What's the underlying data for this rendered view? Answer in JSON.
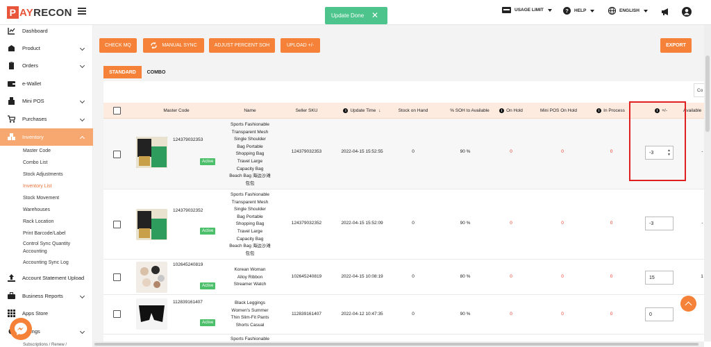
{
  "logo": {
    "boxed_letter": "P",
    "rest_a": "AY",
    "rest_b": "RECON"
  },
  "toast": {
    "message": "Update Done",
    "close": "✕"
  },
  "topbar": {
    "usage": "USAGE LIMIT",
    "help": "HELP",
    "language": "ENGLISH"
  },
  "sidebar": {
    "items": [
      {
        "label": "Dashboard",
        "icon": "chart-icon"
      },
      {
        "label": "Product",
        "icon": "box-icon"
      },
      {
        "label": "Orders",
        "icon": "clipboard-icon"
      },
      {
        "label": "e-Wallet",
        "icon": "wallet-icon"
      },
      {
        "label": "Mini POS",
        "icon": "pos-icon"
      },
      {
        "label": "Purchases",
        "icon": "cart-icon"
      },
      {
        "label": "Inventory",
        "icon": "inventory-icon"
      },
      {
        "label": "Account Statement Upload",
        "icon": "upload-icon"
      },
      {
        "label": "Business Reports",
        "icon": "briefcase-icon"
      },
      {
        "label": "Apps Store",
        "icon": "apps-icon"
      },
      {
        "label": "ings",
        "icon": "settings-icon"
      }
    ],
    "inventory_sub": [
      "Master Code",
      "Combo List",
      "Stock Adjustments",
      "Inventory List",
      "Stock Movement",
      "Warehouses",
      "Rack Location",
      "Print Barcode/Label",
      "Control Sync Quantity",
      "Accounting",
      "Accounting Sync Log"
    ],
    "footer_cut": "Subscriptions / Renew /"
  },
  "toolbar": {
    "check_mq": "CHECK MQ",
    "manual_sync": "MANUAL SYNC",
    "adjust": "ADJUST PERCENT SOH",
    "upload": "UPLOAD +/-",
    "export": "EXPORT"
  },
  "tabs": {
    "standard": "STANDARD",
    "combo": "COMBO"
  },
  "columns_button": "Co",
  "table": {
    "headers": [
      "Master Code",
      "Name",
      "Seller SKU",
      "Update Time",
      "Stock on Hand",
      "% SOH to Available",
      "On Hold",
      "Mini POS On Hold",
      "In Process",
      "+/-",
      "Available"
    ],
    "rows": [
      {
        "code": "124379032353",
        "status": "Active",
        "name": [
          "Sports Fashionable",
          "Transparent Mesh",
          "Single Shoulder",
          "Bag Portable",
          "Shopping Bag",
          "Travel Large",
          "Capacity Bag",
          "Beach Bag 海边沙滩",
          "包包"
        ],
        "sku": "124379032353",
        "time": "2022-04-15 15:52:55",
        "soh": "0",
        "pct": "90 %",
        "hold": "0",
        "pos": "0",
        "proc": "0",
        "adj": "-3",
        "avail": "-"
      },
      {
        "code": "124379032352",
        "status": "Active",
        "name": [
          "Sports Fashionable",
          "Transparent Mesh",
          "Single Shoulder",
          "Bag Portable",
          "Shopping Bag",
          "Travel Large",
          "Capacity Bag",
          "Beach Bag 海边沙滩",
          "包包"
        ],
        "sku": "124379032352",
        "time": "2022-04-15 15:52:09",
        "soh": "0",
        "pct": "90 %",
        "hold": "0",
        "pos": "0",
        "proc": "0",
        "adj": "-3",
        "avail": "-"
      },
      {
        "code": "102645240819",
        "status": "Active",
        "name": [
          "Korean Woman",
          "Alloy Ribbon",
          "Streamer Watch"
        ],
        "sku": "102645240819",
        "time": "2022-04-15 10:08:19",
        "soh": "0",
        "pct": "80 %",
        "hold": "0",
        "pos": "0",
        "proc": "0",
        "adj": "15",
        "avail": "1"
      },
      {
        "code": "112839161407",
        "status": "Active",
        "name": [
          "Black Leggings",
          "Women's Summer",
          "Thin Slim-Fit Pants",
          "Shorts Casual"
        ],
        "sku": "112839161407",
        "time": "2022-04-12 10:47:35",
        "soh": "0",
        "pct": "90 %",
        "hold": "0",
        "pos": "0",
        "proc": "0",
        "adj": "0",
        "avail": ""
      },
      {
        "name_cut": "Sports Fashionable"
      }
    ]
  }
}
